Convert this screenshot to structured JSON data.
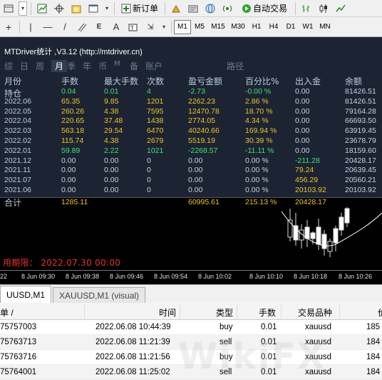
{
  "toolbar": {
    "new_order_label": "新订单",
    "autotrade_label": "自动交易",
    "timeframes": [
      "M1",
      "M5",
      "M15",
      "M30",
      "H1",
      "H4",
      "D1",
      "W1",
      "MN"
    ],
    "active_timeframe": "M1"
  },
  "panel": {
    "title": "MTDriver统计 ,V3.12 (http://mtdriver.cn)",
    "menu": [
      "综",
      "日",
      "周",
      "月",
      "季",
      "年",
      "币",
      "M",
      "备",
      "账户"
    ],
    "menu_selected": "月",
    "path_label": "路径",
    "columns": [
      "月份",
      "手数",
      "最大手数",
      "次数",
      "盈亏金额",
      "百分比%",
      "出入金",
      "余额"
    ],
    "rows": [
      {
        "month": "持仓",
        "lots": "0.04",
        "max_lots": "0.01",
        "count": "4",
        "pnl": "-2.73",
        "pct": "-0.00 %",
        "flow": "0.00",
        "balance": "81426.51",
        "tone": "green"
      },
      {
        "month": "2022.06",
        "lots": "65.35",
        "max_lots": "9.85",
        "count": "1201",
        "pnl": "2262.23",
        "pct": "2.86 %",
        "flow": "0.00",
        "balance": "81426.51",
        "tone": "yellow"
      },
      {
        "month": "2022.05",
        "lots": "260.26",
        "max_lots": "4.38",
        "count": "7595",
        "pnl": "12470.78",
        "pct": "18.70 %",
        "flow": "0.00",
        "balance": "79164.28",
        "tone": "yellow"
      },
      {
        "month": "2022.04",
        "lots": "220.65",
        "max_lots": "37.48",
        "count": "1438",
        "pnl": "2774.05",
        "pct": "4.34 %",
        "flow": "0.00",
        "balance": "66693.50",
        "tone": "yellow"
      },
      {
        "month": "2022.03",
        "lots": "563.18",
        "max_lots": "29.54",
        "count": "6470",
        "pnl": "40240.66",
        "pct": "169.94 %",
        "flow": "0.00",
        "balance": "63919.45",
        "tone": "yellow"
      },
      {
        "month": "2022.02",
        "lots": "115.74",
        "max_lots": "4.38",
        "count": "2679",
        "pnl": "5519.19",
        "pct": "30.39 %",
        "flow": "0.00",
        "balance": "23678.79",
        "tone": "yellow"
      },
      {
        "month": "2022.01",
        "lots": "59.89",
        "max_lots": "2.22",
        "count": "1021",
        "pnl": "-2268.57",
        "pct": "-11.11 %",
        "flow": "0.00",
        "balance": "18159.60",
        "tone": "green"
      },
      {
        "month": "2021.12",
        "lots": "0.00",
        "max_lots": "0.00",
        "count": "0",
        "pnl": "0.00",
        "pct": "0.00 %",
        "flow": "-211.28",
        "balance": "20428.17",
        "tone": "gray_flow_green"
      },
      {
        "month": "2021.11",
        "lots": "0.00",
        "max_lots": "0.00",
        "count": "0",
        "pnl": "0.00",
        "pct": "0.00 %",
        "flow": "79.24",
        "balance": "20639.45",
        "tone": "gray_flow_yellow"
      },
      {
        "month": "2021.07",
        "lots": "0.00",
        "max_lots": "0.00",
        "count": "0",
        "pnl": "0.00",
        "pct": "0.00 %",
        "flow": "456.29",
        "balance": "20560.21",
        "tone": "gray_flow_yellow"
      },
      {
        "month": "2021.06",
        "lots": "0.00",
        "max_lots": "0.00",
        "count": "0",
        "pnl": "0.00",
        "pct": "0.00 %",
        "flow": "20103.92",
        "balance": "20103.92",
        "tone": "gray_flow_yellow"
      }
    ],
    "total": {
      "label": "合计",
      "lots": "1285.11",
      "pnl": "60995.61",
      "pct": "215.13 %",
      "flow": "20428.17"
    }
  },
  "chart": {
    "expire_text": "用期限： 2022.07.30 00:00",
    "time_labels": [
      "22",
      "8 Jun 09:30",
      "8 Jun 09:38",
      "8 Jun 09:46",
      "8 Jun 09:54",
      "8 Jun 10:02",
      "8 Jun 10:10",
      "8 Jun 10:18",
      "8 Jun 10:26"
    ]
  },
  "tabs": {
    "active": "UUSD,M1",
    "inactive": "XAUUSD,M1 (visual)"
  },
  "table": {
    "headers": {
      "order": "单 /",
      "time": "时间",
      "type": "类型",
      "lots": "手数",
      "symbol": "交易品种",
      "price": "价"
    },
    "rows": [
      {
        "order": "75757003",
        "time": "2022.06.08 10:44:39",
        "type": "buy",
        "lots": "0.01",
        "symbol": "xauusd",
        "price": "185"
      },
      {
        "order": "75763713",
        "time": "2022.06.08 11:21:39",
        "type": "sell",
        "lots": "0.01",
        "symbol": "xauusd",
        "price": "184"
      },
      {
        "order": "75763716",
        "time": "2022.06.08 11:21:56",
        "type": "buy",
        "lots": "0.01",
        "symbol": "xauusd",
        "price": "184"
      },
      {
        "order": "75764001",
        "time": "2022.06.08 11:25:02",
        "type": "sell",
        "lots": "0.01",
        "symbol": "xauusd",
        "price": "184"
      }
    ]
  },
  "colors": {
    "panel_bg": "#1c2433",
    "green": "#3ee26a",
    "yellow": "#f0c420",
    "expire_red": "#e5322d"
  },
  "watermark": "WikiFX"
}
